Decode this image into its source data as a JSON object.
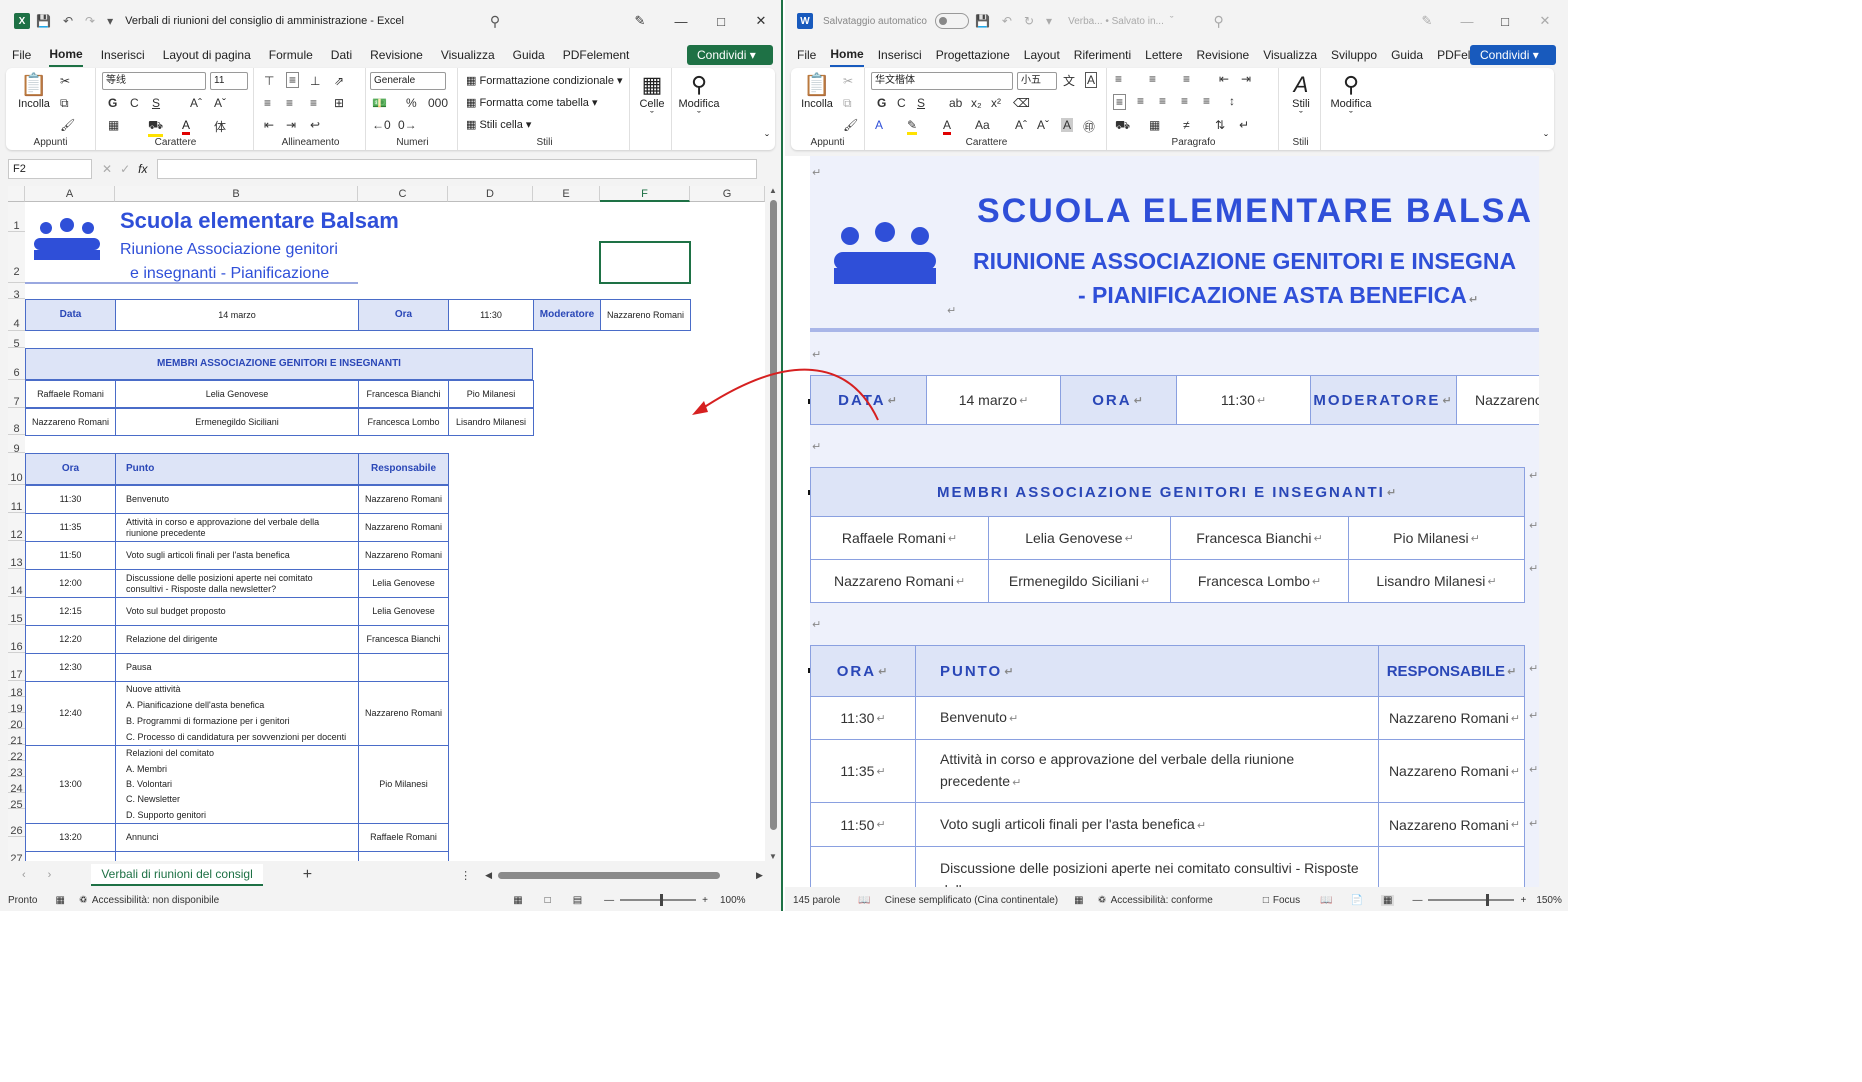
{
  "excel": {
    "window_title": "Verbali di riunioni del consiglio di amministrazione  -  Excel",
    "menu": [
      "File",
      "Home",
      "Inserisci",
      "Layout di pagina",
      "Formule",
      "Dati",
      "Revisione",
      "Visualizza",
      "Guida",
      "PDFelement"
    ],
    "share_label": "Condividi",
    "ribbon": {
      "clipboard": {
        "paste": "Incolla",
        "label": "Appunti"
      },
      "font": {
        "name": "等线",
        "size": "11",
        "label": "Carattere",
        "bold": "G",
        "italic": "C",
        "underline": "S"
      },
      "alignment": {
        "label": "Allineamento"
      },
      "number": {
        "format": "Generale",
        "label": "Numeri"
      },
      "styles": {
        "cond": "Formattazione condizionale",
        "table": "Formatta come tabella",
        "cell": "Stili cella",
        "label": "Stili"
      },
      "cells": {
        "label": "Celle"
      },
      "edit": {
        "label": "Modifica"
      }
    },
    "name_box": "F2",
    "fx": "fx",
    "columns": [
      "A",
      "B",
      "C",
      "D",
      "E",
      "F",
      "G"
    ],
    "rows": [
      "1",
      "2",
      "3",
      "4",
      "5",
      "6",
      "7",
      "8",
      "9",
      "10",
      "11",
      "12",
      "13",
      "14",
      "15",
      "16",
      "17",
      "18",
      "19",
      "20",
      "21",
      "22",
      "23",
      "24",
      "25",
      "26",
      "27"
    ],
    "title": "Scuola elementare Balsam",
    "subtitle1": "Riunione Associazione genitori",
    "subtitle2": "e insegnanti - Pianificazione",
    "info": {
      "data_label": "Data",
      "data_value": "14 marzo",
      "ora_label": "Ora",
      "ora_value": "11:30",
      "mod_label": "Moderatore",
      "mod_value": "Nazzareno Romani"
    },
    "members_header": "MEMBRI ASSOCIAZIONE GENITORI E INSEGNANTI",
    "members": [
      [
        "Raffaele Romani",
        "Lelia Genovese",
        "Francesca Bianchi",
        "Pio Milanesi"
      ],
      [
        "Nazzareno Romani",
        "Ermenegildo Siciliani",
        "Francesca Lombo",
        "Lisandro Milanesi"
      ]
    ],
    "agenda_headers": {
      "ora": "Ora",
      "punto": "Punto",
      "resp": "Responsabile"
    },
    "agenda": [
      {
        "ora": "11:30",
        "punto": [
          "Benvenuto"
        ],
        "resp": "Nazzareno Romani"
      },
      {
        "ora": "11:35",
        "punto": [
          "Attività in corso e approvazione del verbale della",
          "riunione precedente"
        ],
        "resp": "Nazzareno Romani"
      },
      {
        "ora": "11:50",
        "punto": [
          "Voto sugli articoli finali per l'asta benefica"
        ],
        "resp": "Nazzareno Romani"
      },
      {
        "ora": "12:00",
        "punto": [
          "Discussione delle posizioni aperte nei comitato",
          "consultivi - Risposte dalla newsletter?"
        ],
        "resp": "Lelia Genovese"
      },
      {
        "ora": "12:15",
        "punto": [
          "Voto sul budget proposto"
        ],
        "resp": "Lelia Genovese"
      },
      {
        "ora": "12:20",
        "punto": [
          "Relazione del dirigente"
        ],
        "resp": "Francesca Bianchi"
      },
      {
        "ora": "12:30",
        "punto": [
          "Pausa"
        ],
        "resp": ""
      },
      {
        "ora": "12:40",
        "punto": [
          "Nuove attività",
          "A. Pianificazione dell'asta benefica",
          "B. Programmi di formazione per i genitori",
          "C. Processo di candidatura per sovvenzioni per docenti"
        ],
        "resp": "Nazzareno Romani"
      },
      {
        "ora": "13:00",
        "punto": [
          "Relazioni del comitato",
          "A. Membri",
          "B. Volontari",
          "C. Newsletter",
          "D. Supporto genitori"
        ],
        "resp": "Pio Milanesi"
      },
      {
        "ora": "13:20",
        "punto": [
          "Annunci"
        ],
        "resp": "Raffaele Romani"
      }
    ],
    "sheet_tab": "Verbali di riunioni del consigl",
    "status_ready": "Pronto",
    "status_access": "Accessibilità: non disponibile",
    "zoom": "100%"
  },
  "word": {
    "autosave": "Salvataggio automatico",
    "doc_title": "Verba... • Salvato in...",
    "menu": [
      "File",
      "Home",
      "Inserisci",
      "Progettazione",
      "Layout",
      "Riferimenti",
      "Lettere",
      "Revisione",
      "Visualizza",
      "Sviluppo",
      "Guida",
      "PDFelement"
    ],
    "share_label": "Condividi",
    "ribbon": {
      "clipboard": {
        "paste": "Incolla",
        "label": "Appunti"
      },
      "font": {
        "name": "华文楷体",
        "size": "小五",
        "label": "Carattere",
        "bold": "G",
        "italic": "C",
        "underline": "S"
      },
      "paragraph": {
        "label": "Paragrafo"
      },
      "styles": {
        "label": "Stili",
        "btn": "Stili"
      },
      "edit": {
        "label": "Modifica"
      }
    },
    "title": "SCUOLA ELEMENTARE BALSA",
    "subtitle1": "RIUNIONE ASSOCIAZIONE GENITORI E INSEGNA",
    "subtitle2": "- PIANIFICAZIONE ASTA BENEFICA",
    "info": {
      "data_label": "DATA",
      "data_value": "14 marzo",
      "ora_label": "ORA",
      "ora_value": "11:30",
      "mod_label": "MODERATORE",
      "mod_value": "Nazzareno R"
    },
    "members_header": "MEMBRI ASSOCIAZIONE GENITORI E INSEGNANTI",
    "members": [
      [
        "Raffaele Romani",
        "Lelia Genovese",
        "Francesca Bianchi",
        "Pio Milanesi"
      ],
      [
        "Nazzareno Romani",
        "Ermenegildo Siciliani",
        "Francesca Lombo",
        "Lisandro Milanesi"
      ]
    ],
    "agenda_headers": {
      "ora": "ORA",
      "punto": "PUNTO",
      "resp": "RESPONSABILE"
    },
    "agenda": [
      {
        "ora": "11:30",
        "punto": [
          "Benvenuto"
        ],
        "resp": "Nazzareno Romani"
      },
      {
        "ora": "11:35",
        "punto": [
          "Attività in corso e approvazione del verbale della riunione",
          "precedente"
        ],
        "resp": "Nazzareno Romani"
      },
      {
        "ora": "11:50",
        "punto": [
          "Voto sugli articoli finali per l'asta benefica"
        ],
        "resp": "Nazzareno Romani"
      },
      {
        "ora": "",
        "punto": [
          "Discussione delle posizioni aperte nei comitato consultivi - Risposte dalla"
        ],
        "resp": ""
      }
    ],
    "status_words": "145 parole",
    "status_lang": "Cinese semplificato (Cina continentale)",
    "status_access": "Accessibilità: conforme",
    "status_focus": "Focus",
    "zoom": "150%"
  },
  "colors": {
    "excel": "#1e7145",
    "word": "#185abd",
    "accent": "#2f4fd8",
    "header_fill": "#dde4f7",
    "arrow": "#d62020"
  }
}
